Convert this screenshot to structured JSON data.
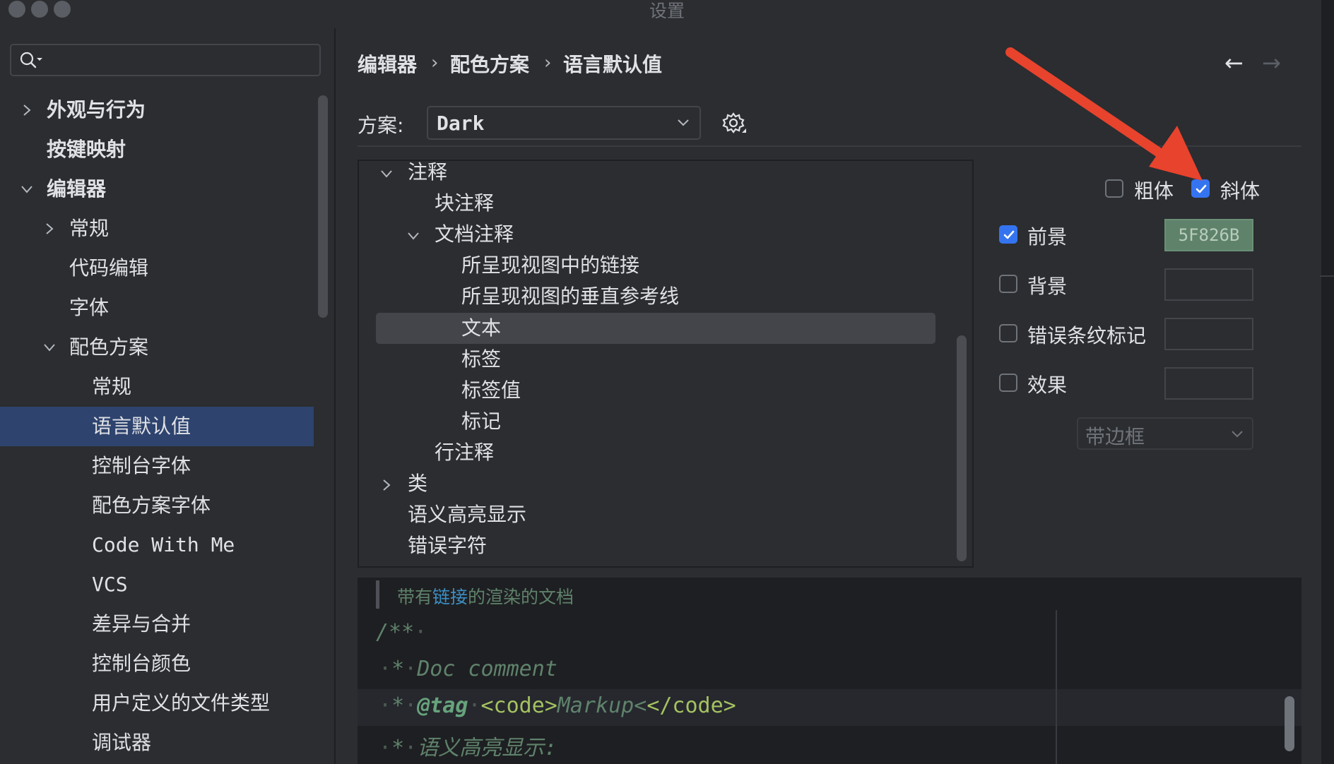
{
  "window": {
    "title": "设置"
  },
  "sidebar": {
    "search_placeholder": "",
    "items": [
      {
        "label": "外观与行为"
      },
      {
        "label": "按键映射"
      },
      {
        "label": "编辑器"
      },
      {
        "label": "常规"
      },
      {
        "label": "代码编辑"
      },
      {
        "label": "字体"
      },
      {
        "label": "配色方案"
      },
      {
        "label": "常规"
      },
      {
        "label": "语言默认值"
      },
      {
        "label": "控制台字体"
      },
      {
        "label": "配色方案字体"
      },
      {
        "label": "Code With Me"
      },
      {
        "label": "VCS"
      },
      {
        "label": "差异与合并"
      },
      {
        "label": "控制台颜色"
      },
      {
        "label": "用户定义的文件类型"
      },
      {
        "label": "调试器"
      }
    ]
  },
  "breadcrumb": [
    "编辑器",
    "配色方案",
    "语言默认值"
  ],
  "breadcrumb_sep": "›",
  "nav": {
    "back": "←",
    "forward": "→"
  },
  "scheme": {
    "label": "方案:",
    "value": "Dark"
  },
  "tree": {
    "items": [
      {
        "label": "注释"
      },
      {
        "label": "块注释"
      },
      {
        "label": "文档注释"
      },
      {
        "label": "所呈现视图中的链接"
      },
      {
        "label": "所呈现视图的垂直参考线"
      },
      {
        "label": "文本"
      },
      {
        "label": "标签"
      },
      {
        "label": "标签值"
      },
      {
        "label": "标记"
      },
      {
        "label": "行注释"
      },
      {
        "label": "类"
      },
      {
        "label": "语义高亮显示"
      },
      {
        "label": "错误字符"
      }
    ]
  },
  "attributes": {
    "bold": {
      "label": "粗体",
      "checked": false
    },
    "italic": {
      "label": "斜体",
      "checked": true
    },
    "foreground": {
      "label": "前景",
      "checked": true,
      "value": "5F826B",
      "color": "#5f826b"
    },
    "background": {
      "label": "背景",
      "checked": false
    },
    "error_stripe": {
      "label": "错误条纹标记",
      "checked": false
    },
    "effects": {
      "label": "效果",
      "checked": false,
      "type": "带边框"
    }
  },
  "preview": {
    "doc_text_1": "带有",
    "doc_link": "链接",
    "doc_text_2": "的渲染的文档",
    "line1": "/**",
    "line2_star": "*",
    "line2_text": "Doc comment",
    "line3_star": "*",
    "line3_tag": "@tag",
    "line3_open": "<code>",
    "line3_text": "Markup<",
    "line3_close": "</code>",
    "line4_star": "*",
    "line4_text": "语义高亮显示:"
  },
  "colors": {
    "accent": "#3574f0",
    "selection": "#2e436e",
    "annotation": "#e8432d"
  }
}
